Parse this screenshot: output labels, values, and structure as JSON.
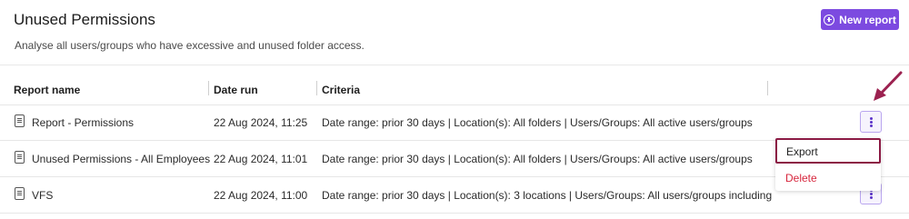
{
  "page": {
    "title": "Unused Permissions",
    "subtitle": "Analyse all users/groups who have excessive and unused folder access.",
    "new_report_label": "New report"
  },
  "table": {
    "columns": [
      "Report name",
      "Date run",
      "Criteria"
    ],
    "rows": [
      {
        "name": "Report - Permissions",
        "date": "22 Aug 2024, 11:25",
        "criteria": "Date range: prior 30 days | Location(s): All folders | Users/Groups: All active users/groups"
      },
      {
        "name": "Unused Permissions - All Employees",
        "date": "22 Aug 2024, 11:01",
        "criteria": "Date range: prior 30 days | Location(s): All folders | Users/Groups: All active users/groups"
      },
      {
        "name": "VFS",
        "date": "22 Aug 2024, 11:00",
        "criteria": "Date range: prior 30 days | Location(s): 3 locations | Users/Groups: All users/groups including"
      }
    ]
  },
  "menu": {
    "items": [
      "Export",
      "Delete"
    ]
  },
  "colors": {
    "accent": "#7c4ae0",
    "highlight_box": "#8b1a44",
    "annotation_arrow": "#9c2250",
    "danger": "#d7263d"
  },
  "icons": {
    "new_report": "plus-circle-icon",
    "report_row": "document-icon",
    "row_actions": "kebab-vertical-icon",
    "annotation": "arrow-icon"
  }
}
